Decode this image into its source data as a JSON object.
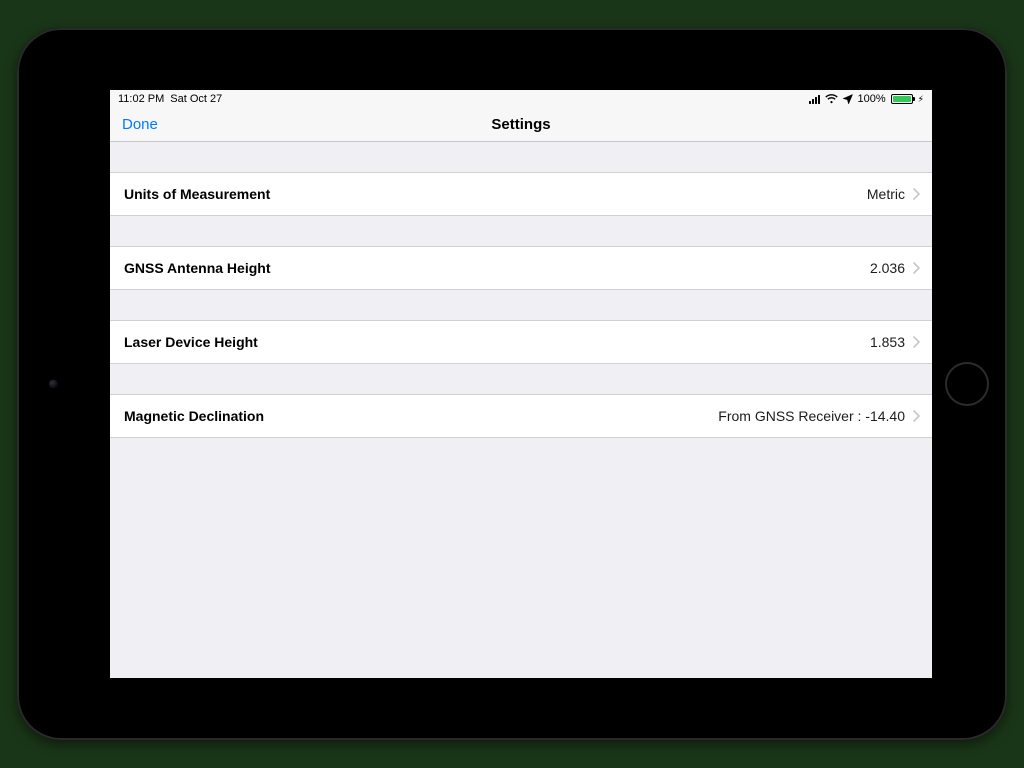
{
  "status": {
    "time": "11:02 PM",
    "date": "Sat Oct 27",
    "battery_percent": "100%"
  },
  "nav": {
    "done": "Done",
    "title": "Settings"
  },
  "rows": {
    "units": {
      "label": "Units of Measurement",
      "value": "Metric"
    },
    "antenna": {
      "label": "GNSS Antenna Height",
      "value": "2.036"
    },
    "laser": {
      "label": "Laser Device Height",
      "value": "1.853"
    },
    "declination": {
      "label": "Magnetic Declination",
      "value": "From GNSS Receiver : -14.40"
    }
  }
}
